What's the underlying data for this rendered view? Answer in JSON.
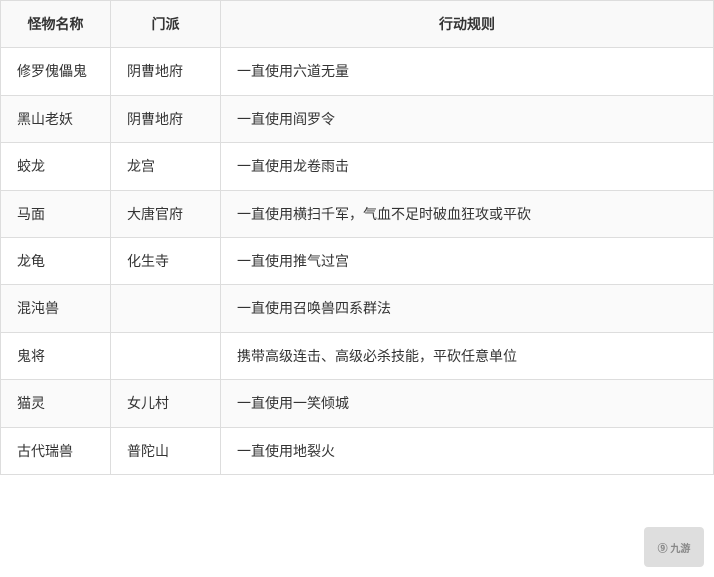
{
  "table": {
    "headers": [
      {
        "key": "name",
        "label": "怪物名称"
      },
      {
        "key": "faction",
        "label": "门派"
      },
      {
        "key": "rule",
        "label": "行动规则"
      }
    ],
    "rows": [
      {
        "name": "修罗傀儡鬼",
        "faction": "阴曹地府",
        "rule": "一直使用六道无量"
      },
      {
        "name": "黑山老妖",
        "faction": "阴曹地府",
        "rule": "一直使用阎罗令"
      },
      {
        "name": "蛟龙",
        "faction": "龙宫",
        "rule": "一直使用龙卷雨击"
      },
      {
        "name": "马面",
        "faction": "大唐官府",
        "rule": "一直使用横扫千军，气血不足时破血狂攻或平砍"
      },
      {
        "name": "龙龟",
        "faction": "化生寺",
        "rule": "一直使用推气过宫"
      },
      {
        "name": "混沌兽",
        "faction": "",
        "rule": "一直使用召唤兽四系群法"
      },
      {
        "name": "鬼将",
        "faction": "",
        "rule": "携带高级连击、高级必杀技能，平砍任意单位"
      },
      {
        "name": "猫灵",
        "faction": "女儿村",
        "rule": "一直使用一笑倾城"
      },
      {
        "name": "古代瑞兽",
        "faction": "普陀山",
        "rule": "一直使用地裂火"
      }
    ]
  },
  "watermark": {
    "text": "9游",
    "icon": "G"
  }
}
